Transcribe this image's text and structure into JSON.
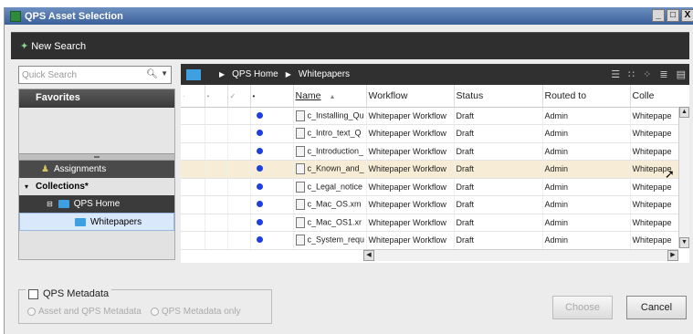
{
  "window": {
    "title": "QPS Asset Selection",
    "controls": [
      "_",
      "□",
      "X"
    ]
  },
  "toolbar": {
    "new_search_label": "New Search"
  },
  "search": {
    "placeholder": "Quick Search"
  },
  "sidebar": {
    "favorites_label": "Favorites",
    "assignments_label": "Assignments",
    "collections_label": "Collections*",
    "qps_home_label": "QPS Home",
    "whitepapers_label": "Whitepapers"
  },
  "breadcrumb": {
    "items": [
      "QPS Home",
      "Whitepapers"
    ]
  },
  "table": {
    "columns": [
      "Name",
      "Workflow",
      "Status",
      "Routed to",
      "Colle"
    ],
    "rows": [
      {
        "name": "c_Installing_Qu",
        "workflow": "Whitepaper Workflow",
        "status": "Draft",
        "routed_to": "Admin",
        "collection": "Whitepape"
      },
      {
        "name": "c_Intro_text_Q",
        "workflow": "Whitepaper Workflow",
        "status": "Draft",
        "routed_to": "Admin",
        "collection": "Whitepape"
      },
      {
        "name": "c_Introduction_",
        "workflow": "Whitepaper Workflow",
        "status": "Draft",
        "routed_to": "Admin",
        "collection": "Whitepape"
      },
      {
        "name": "c_Known_and_",
        "workflow": "Whitepaper Workflow",
        "status": "Draft",
        "routed_to": "Admin",
        "collection": "Whitepape"
      },
      {
        "name": "c_Legal_notice",
        "workflow": "Whitepaper Workflow",
        "status": "Draft",
        "routed_to": "Admin",
        "collection": "Whitepape"
      },
      {
        "name": "c_Mac_OS.xm",
        "workflow": "Whitepaper Workflow",
        "status": "Draft",
        "routed_to": "Admin",
        "collection": "Whitepape"
      },
      {
        "name": "c_Mac_OS1.xr",
        "workflow": "Whitepaper Workflow",
        "status": "Draft",
        "routed_to": "Admin",
        "collection": "Whitepape"
      },
      {
        "name": "c_System_requ",
        "workflow": "Whitepaper Workflow",
        "status": "Draft",
        "routed_to": "Admin",
        "collection": "Whitepape"
      }
    ]
  },
  "metadata": {
    "checkbox_label": "QPS Metadata",
    "option_asset_and_meta": "Asset and QPS Metadata",
    "option_meta_only": "QPS Metadata only"
  },
  "buttons": {
    "choose": "Choose",
    "cancel": "Cancel"
  }
}
